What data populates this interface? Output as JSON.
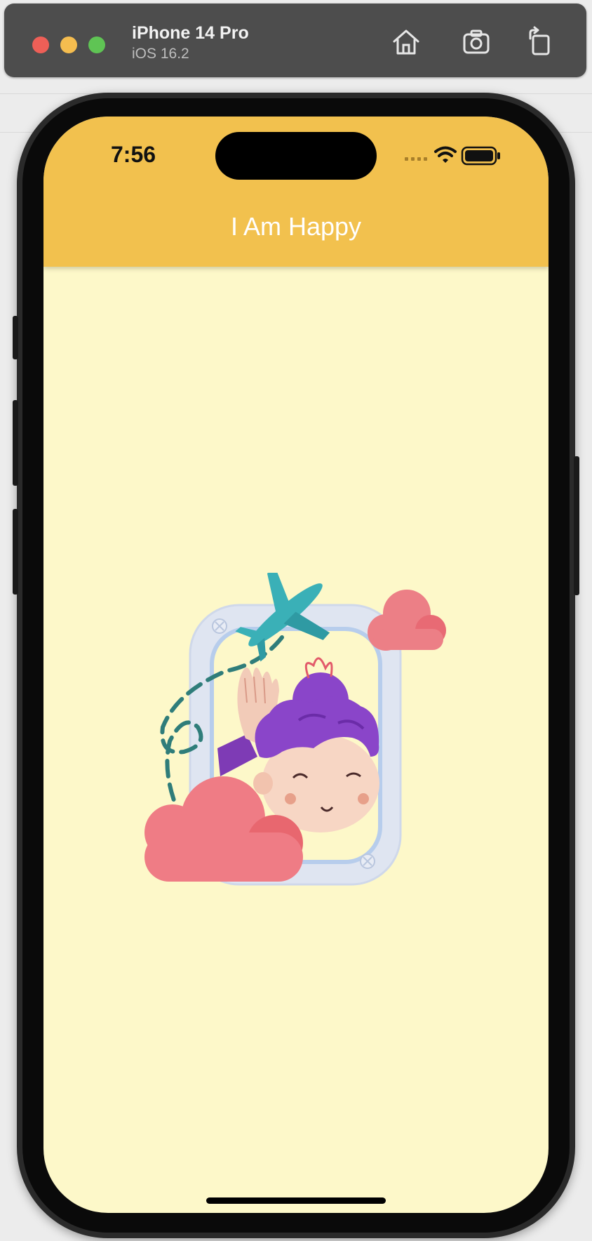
{
  "simulator": {
    "device_name": "iPhone 14 Pro",
    "os_version": "iOS 16.2",
    "toolbar_icons": [
      "home-icon",
      "screenshot-icon",
      "rotate-icon"
    ]
  },
  "status_bar": {
    "time": "7:56",
    "icons": [
      "cellular-signal-icon",
      "wifi-icon",
      "battery-icon"
    ]
  },
  "app": {
    "title": "I Am Happy",
    "colors": {
      "appbar": "#f2c14e",
      "background": "#fdf8c9",
      "title_text": "#ffffff"
    },
    "illustration": "airplane-window-waving-girl-illustration"
  }
}
